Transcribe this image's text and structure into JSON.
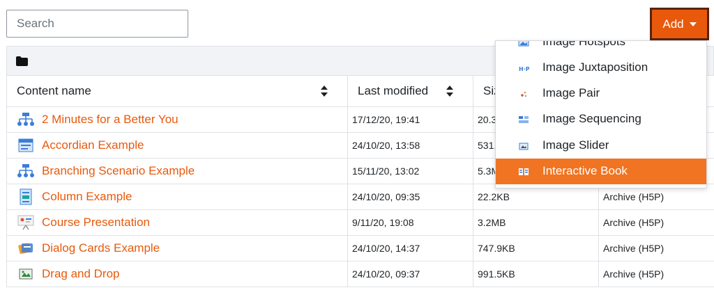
{
  "search": {
    "placeholder": "Search"
  },
  "add_button": {
    "label": "Add"
  },
  "table": {
    "headers": {
      "name": "Content name",
      "modified": "Last modified",
      "size": "Size"
    },
    "rows": [
      {
        "name": "2 Minutes for a Better You",
        "modified": "17/12/20, 19:41",
        "size": "20.3",
        "type": "",
        "icon": "branching-icon"
      },
      {
        "name": "Accordian Example",
        "modified": "24/10/20, 13:58",
        "size": "531.",
        "type": "",
        "icon": "accordion-icon"
      },
      {
        "name": "Branching Scenario Example",
        "modified": "15/11/20, 13:02",
        "size": "5.3M",
        "type": "",
        "icon": "branching-icon"
      },
      {
        "name": "Column Example",
        "modified": "24/10/20, 09:35",
        "size": "22.2KB",
        "type": "Archive (H5P)",
        "icon": "column-icon"
      },
      {
        "name": "Course Presentation",
        "modified": "9/11/20, 19:08",
        "size": "3.2MB",
        "type": "Archive (H5P)",
        "icon": "presentation-icon"
      },
      {
        "name": "Dialog Cards Example",
        "modified": "24/10/20, 14:37",
        "size": "747.9KB",
        "type": "Archive (H5P)",
        "icon": "dialog-cards-icon"
      },
      {
        "name": "Drag and Drop",
        "modified": "24/10/20, 09:37",
        "size": "991.5KB",
        "type": "Archive (H5P)",
        "icon": "drag-drop-icon"
      }
    ]
  },
  "dropdown": {
    "items": [
      {
        "label": "Image Hotspots",
        "icon": "image-hotspots-icon",
        "active": false
      },
      {
        "label": "Image Juxtaposition",
        "icon": "h5p-icon",
        "active": false
      },
      {
        "label": "Image Pair",
        "icon": "image-pair-icon",
        "active": false
      },
      {
        "label": "Image Sequencing",
        "icon": "image-sequencing-icon",
        "active": false
      },
      {
        "label": "Image Slider",
        "icon": "image-slider-icon",
        "active": false
      },
      {
        "label": "Interactive Book",
        "icon": "interactive-book-icon",
        "active": true
      }
    ]
  },
  "colors": {
    "accent": "#e8590c",
    "active_item": "#f07422",
    "link": "#e8590c"
  }
}
